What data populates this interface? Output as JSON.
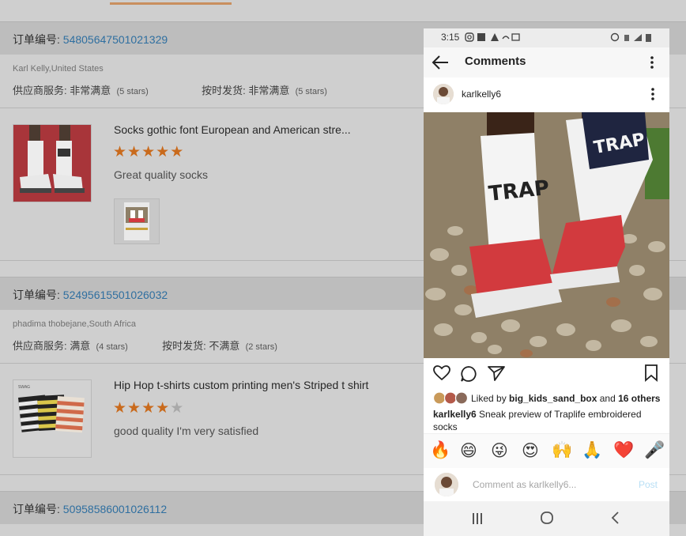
{
  "background_page": {
    "orders": [
      {
        "order_label": "订单编号: ",
        "order_number": "54805647501021329",
        "buyer": "Karl Kelly,United States",
        "supplier_service_label": "供应商服务: ",
        "supplier_service_value": "非常满意",
        "supplier_stars": "(5 stars)",
        "on_time_label": "按时发货: ",
        "on_time_value": "非常满意",
        "on_time_stars": "(5 stars)",
        "product_title": "Socks gothic font European and American stre...",
        "rating": 5,
        "review": "Great quality socks"
      },
      {
        "order_label": "订单编号: ",
        "order_number": "52495615501026032",
        "buyer": "phadima thobejane,South Africa",
        "supplier_service_label": "供应商服务: ",
        "supplier_service_value": "满意",
        "supplier_stars": "(4 stars)",
        "on_time_label": "按时发货: ",
        "on_time_value": "不满意",
        "on_time_stars": "(2 stars)",
        "product_title": "Hip Hop t-shirts custom printing men's Striped t shirt",
        "rating": 4,
        "review": "good quality I'm very satisfied"
      },
      {
        "order_label": "订单编号: ",
        "order_number": "50958586001026112"
      }
    ]
  },
  "phone": {
    "status_time": "3:15",
    "header_title": "Comments",
    "post_username": "karlkelly6",
    "liked_prefix": "Liked by ",
    "liked_user": "big_kids_sand_box",
    "liked_mid": " and ",
    "liked_others": "16 others",
    "caption_user": "karlkelly6",
    "caption_text": " Sneak preview of Traplife embroidered socks",
    "emojis": [
      "🔥",
      "😄",
      "😜",
      "😍",
      "🙌",
      "🙏",
      "❤️",
      "🎤"
    ],
    "comment_placeholder": "Comment as karlkelly6...",
    "post_button": "Post"
  },
  "colors": {
    "order_number": "#2f6fa0",
    "star_on": "#c96a1c",
    "post_button": "#b8dff5",
    "sock_red": "#d23a3e"
  }
}
